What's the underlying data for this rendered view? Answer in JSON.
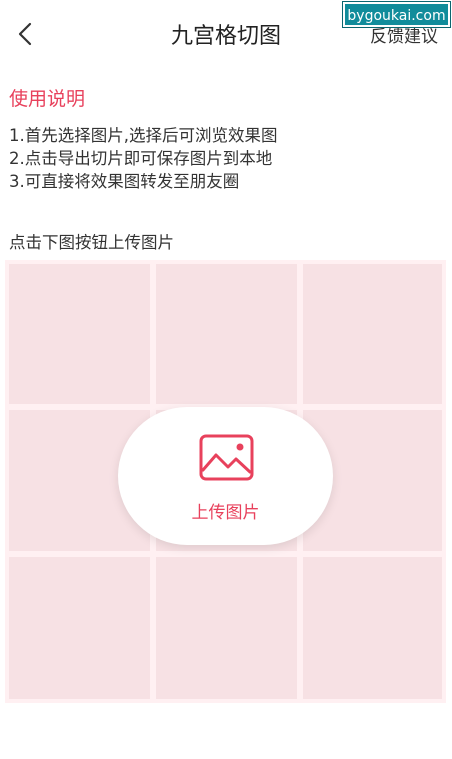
{
  "header": {
    "title": "九宫格切图",
    "feedback_label": "反馈建议",
    "back_icon": "chevron-left-icon"
  },
  "watermark": "bygoukai.com",
  "usage": {
    "heading": "使用说明",
    "lines": [
      "1.首先选择图片,选择后可浏览效果图",
      "2.点击导出切片即可保存图片到本地",
      "3.可直接将效果图转发至朋友圈"
    ]
  },
  "hint": "点击下图按钮上传图片",
  "upload": {
    "label": "上传图片",
    "icon": "image-icon"
  },
  "colors": {
    "accent": "#e8415c",
    "cell": "#f7e1e4",
    "grid_gap": "#fff0f2"
  }
}
